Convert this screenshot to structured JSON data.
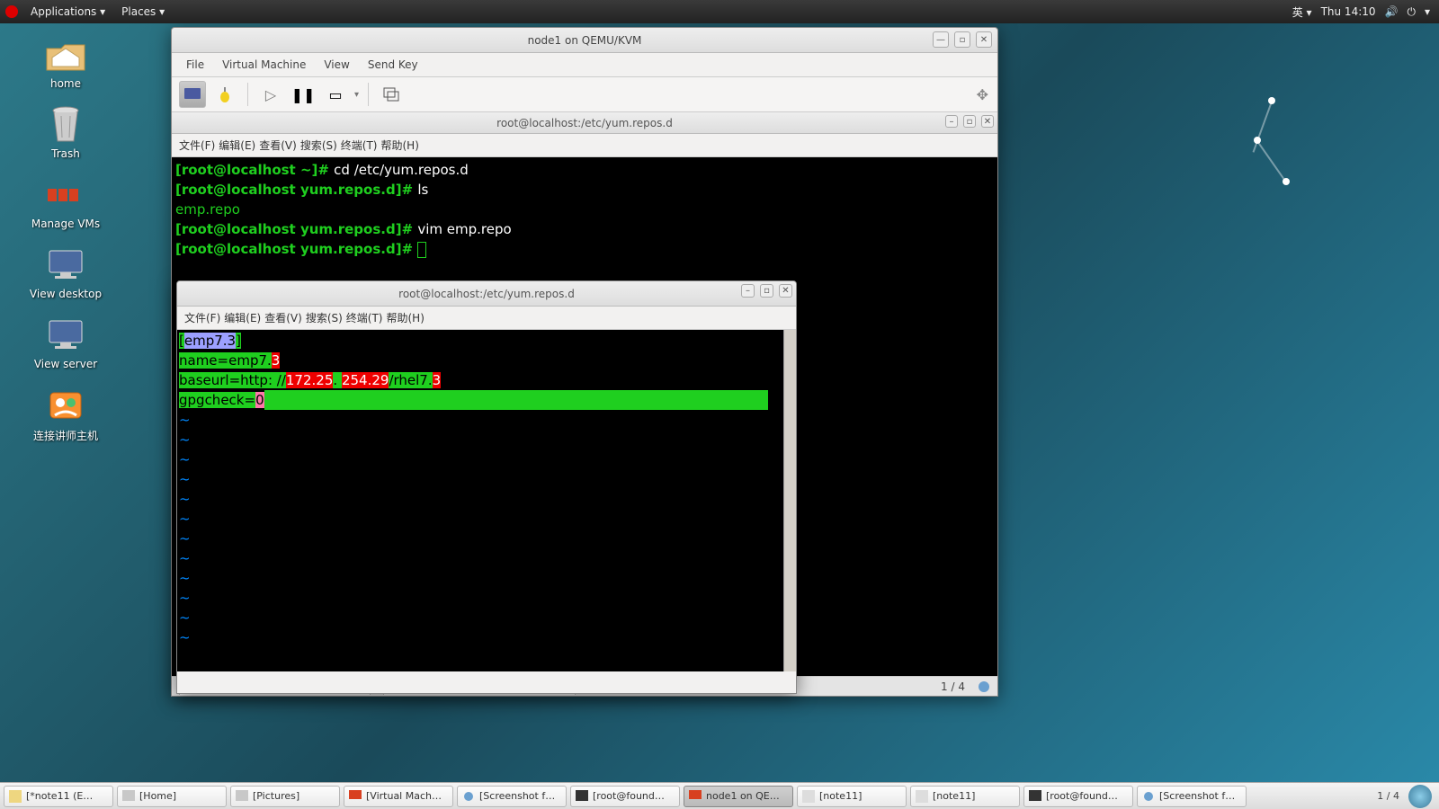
{
  "panel": {
    "applications": "Applications",
    "places": "Places",
    "input_lang": "英",
    "clock": "Thu 14:10"
  },
  "desktop": {
    "home": "home",
    "trash": "Trash",
    "manage_vms": "Manage VMs",
    "view_desktop": "View desktop",
    "view_server": "View server",
    "connect": "连接讲师主机"
  },
  "vm_window": {
    "title": "node1 on QEMU/KVM",
    "menu": {
      "file": "File",
      "vm": "Virtual Machine",
      "view": "View",
      "sendkey": "Send Key"
    },
    "inner_title": "root@localhost:/etc/yum.repos.d",
    "inner_menu": {
      "file": "文件(F)",
      "edit": "编辑(E)",
      "view": "查看(V)",
      "search": "搜索(S)",
      "terminal": "终端(T)",
      "help": "帮助(H)"
    },
    "term_lines": {
      "l1a": "[root@localhost ~]# ",
      "l1b": "cd /etc/yum.repos.d",
      "l2a": "[root@localhost yum.repos.d]# ",
      "l2b": "ls",
      "l3": "emp.repo",
      "l4a": "[root@localhost yum.repos.d]# ",
      "l4b": "vim emp.repo",
      "l5a": "[root@localhost yum.repos.d]# "
    },
    "tab1": "root@localhost:/etc/yum.repos.d",
    "tab2": "root@localhost:/etc/yum.repos.d",
    "page": "1 / 4"
  },
  "nested": {
    "title": "root@localhost:/etc/yum.repos.d",
    "menu": {
      "file": "文件(F)",
      "edit": "编辑(E)",
      "view": "查看(V)",
      "search": "搜索(S)",
      "terminal": "终端(T)",
      "help": "帮助(H)"
    },
    "vim": {
      "sec_open": "[",
      "sec_lbl": "emp7.3",
      "sec_close": "]",
      "name_key": "name=emp7.",
      "name_v": "3",
      "url_key": "baseurl=http: //",
      "ip1": "172.25",
      "dot": ". ",
      "ip2": "254.29",
      "url_rest": "/rhel7.",
      "url_v": "3",
      "gpg_key": "gpgcheck=",
      "gpg_v": "0",
      "tilde": "~"
    }
  },
  "taskbar": {
    "t1": "[*note11 (E…",
    "t2": "[Home]",
    "t3": "[Pictures]",
    "t4": "[Virtual Mach…",
    "t5": "[Screenshot f…",
    "t6": "[root@found…",
    "t7": "node1 on QE…",
    "t8": "[note11]",
    "t9": "[note11]",
    "t10": "[root@found…",
    "t11": "[Screenshot f…",
    "pager": "1 / 4"
  }
}
